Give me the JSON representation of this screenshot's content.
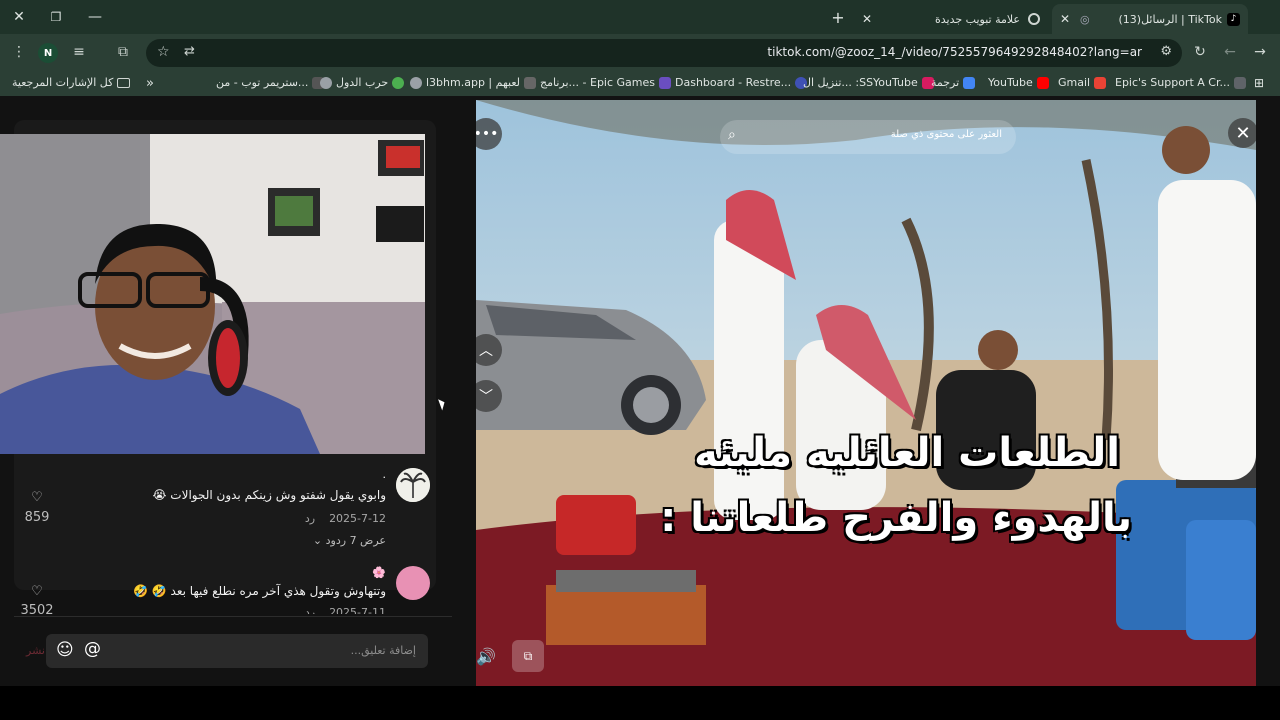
{
  "tabs": [
    {
      "title": "(13)الرسائل | TikTok",
      "active": true
    },
    {
      "title": "علامة تبويب جديدة",
      "active": false
    }
  ],
  "window_controls": {
    "close": "✕",
    "restore": "❐",
    "minimize": "—",
    "new_tab": "+"
  },
  "toolbar": {
    "url": "tiktok.com/@zooz_14_/video/7525579649292848402?lang=ar",
    "profile_initial": "N"
  },
  "bookmarks": [
    {
      "label": "Epic's Support A Cr...",
      "color": "#5f6368"
    },
    {
      "label": "Gmail",
      "color": "#ea4335"
    },
    {
      "label": "YouTube",
      "color": "#ff0000"
    },
    {
      "label": "ترجمة",
      "color": "#4285f4"
    },
    {
      "label": "تنزيل ال... :SSYouTube",
      "color": "#d81b60"
    },
    {
      "label": "Dashboard - Restre...",
      "color": "#3f51b5"
    },
    {
      "label": "برنامج... - Epic Games",
      "color": "#6a4ec0"
    },
    {
      "label": "l3bhm.app | لعبهم",
      "color": "#999999"
    },
    {
      "label": "حرب الدول",
      "color": "#9aa0a6"
    },
    {
      "label": "ستريمر توب - من...",
      "color": "#9aa0a6"
    }
  ],
  "bookmarks_all": "كل الإشارات المرجعية",
  "video": {
    "search_placeholder": "العثور على محتوى ذي صلة",
    "caption_line1": "الطلعات العائليه مليئه",
    "caption_line2": "بالهدوء والفرح طلعاتنا :"
  },
  "comments": [
    {
      "text": "وابوي يقول شفتو وش زينكم بدون الجوالات 😭",
      "date": "2025-7-12",
      "reply": "رد",
      "likes": "859",
      "view_replies": "عرض 7 ردود",
      "name_mark": "."
    },
    {
      "text": "وتتهاوش وتقول هذي آخر مره نطلع فيها بعد 🤣 🤣",
      "date": "2025-7-11",
      "reply": "رد",
      "likes": "3502",
      "name_mark": "🌸"
    }
  ],
  "comment_input": {
    "placeholder": "إضافة تعليق...",
    "post": "نشر"
  },
  "colors": {
    "tab_bg": "#1f3329",
    "toolbar_bg": "#2b3f35",
    "page_bg": "#121212"
  }
}
